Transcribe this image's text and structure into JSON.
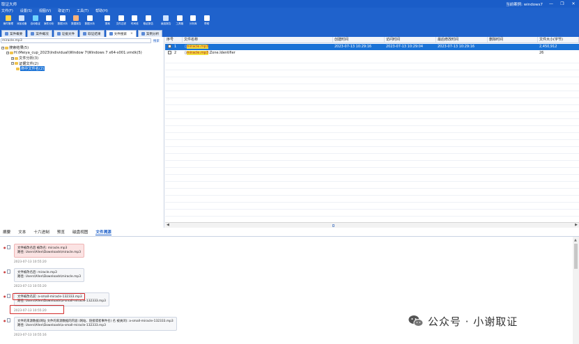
{
  "app": {
    "title": "取证大师",
    "status_label": "当前案例: windows7",
    "controls": [
      "—",
      "❒",
      "✕"
    ]
  },
  "menu": [
    "文件(F)",
    "设置(S)",
    "视图(V)",
    "取证(T)",
    "工具(T)",
    "帮助(H)"
  ],
  "toolbar": [
    {
      "label": "案件管理",
      "color": "#ffd34d"
    },
    {
      "label": "添加设备",
      "color": "#cfe3ff"
    },
    {
      "label": "自动取证",
      "color": "#6fd3ff"
    },
    {
      "label": "案件分析",
      "color": "#ffffff"
    },
    {
      "label": "数据分析",
      "color": "#ffffff"
    },
    {
      "label": "数据报告",
      "color": "#ffb37a"
    },
    {
      "label": "数据分析",
      "color": "#ffffff"
    },
    {
      "label": "搜索",
      "color": "#ffffff"
    },
    {
      "label": "文件过滤",
      "color": "#ffffff"
    },
    {
      "label": "时间线",
      "color": "#ffffff"
    },
    {
      "label": "取证报告",
      "color": "#ffffff"
    },
    {
      "label": "痕迹报告",
      "color": "#cfe3ff"
    },
    {
      "label": "工具箱",
      "color": "#ffffff"
    },
    {
      "label": "分析库",
      "color": "#ffffff"
    },
    {
      "label": "帮助",
      "color": "#ffffff"
    }
  ],
  "tabs": [
    {
      "label": "案件概要",
      "active": false
    },
    {
      "label": "案件概况",
      "active": false
    },
    {
      "label": "证据文件",
      "active": false
    },
    {
      "label": "取证结果",
      "active": false
    },
    {
      "label": "文件搜索",
      "active": true
    },
    {
      "label": "案例分析",
      "active": false
    }
  ],
  "search": {
    "value": "miracle.mp3",
    "link": "搜索"
  },
  "tree": [
    {
      "label": "搜索结果(5)",
      "indent": 0,
      "expander": "−"
    },
    {
      "label": "H:\\Meiya_cup_2023\\Individual\\Window 7\\Windows 7 x64-s001.vmdk(5)",
      "indent": 1,
      "expander": "−"
    },
    {
      "label": "文件分析(3)",
      "indent": 2,
      "expander": "+"
    },
    {
      "label": "证据文件(2)",
      "indent": 2,
      "expander": "−"
    },
    {
      "label": "命中文件名(2)",
      "indent": 3,
      "expander": "",
      "selected": true
    }
  ],
  "grid": {
    "columns": [
      "序号",
      "文件名称",
      "创建时间",
      "访问时间",
      "最后修改时间",
      "删除时间",
      "文件大小(字节)"
    ],
    "rows": [
      {
        "index": "1",
        "name_hl": "miracle.mp3",
        "name_rest": "",
        "created": "2023-07-13 10:29:16",
        "accessed": "2023-07-13 10:29:04",
        "modified": "2023-07-13 10:29:16",
        "deleted": "",
        "size": "2,450,912",
        "selected": true
      },
      {
        "index": "2",
        "name_hl": "miracle.mp3",
        "name_rest": ":Zone.Identifier",
        "created": "",
        "accessed": "",
        "modified": "",
        "deleted": "",
        "size": "26",
        "selected": false
      }
    ]
  },
  "bottom_tabs": [
    {
      "label": "摘要",
      "active": false
    },
    {
      "label": "文本",
      "active": false
    },
    {
      "label": "十六进制",
      "active": false
    },
    {
      "label": "预览",
      "active": false
    },
    {
      "label": "磁盘视图",
      "active": false
    },
    {
      "label": "文件溯源",
      "active": true
    }
  ],
  "trace": [
    {
      "lines": [
        "文件被改名后 被改名: miracle.mp3",
        "路径: Users\\Allen\\Downloads\\miracle.mp3"
      ],
      "time": "2023-07-13 10:55:20",
      "red": true
    },
    {
      "lines": [
        "文件被改名后: miracle.mp3",
        "路径: Users\\Allen\\Downloads\\miracle.mp3"
      ],
      "time": "2023-07-13 10:55:20",
      "red": false
    },
    {
      "lines": [
        "文件被改名前: a-small-miracle-132333.mp3",
        "路径: Users\\Allen\\Downloads\\a-small-miracle-132333.mp3"
      ],
      "time": "2023-07-13 10:55:20",
      "red": false
    },
    {
      "lines": [
        "文件的来源数据(网址 文件的来源数据的内容 (网站、链接或者事件名) 名 被关闭): a-small-miracle-132333.mp3",
        "路径: Users\\Allen\\Downloads\\a-small-miracle-132333.mp3"
      ],
      "time": "2023-07-13 10:55:16",
      "red": false
    }
  ],
  "watermark": {
    "text": "公众号 · 小谢取证"
  }
}
